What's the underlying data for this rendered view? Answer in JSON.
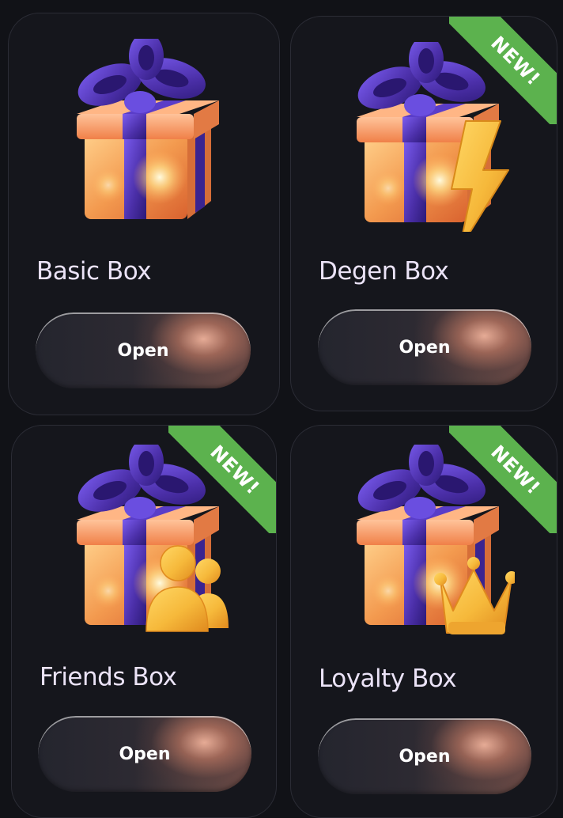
{
  "boxes": [
    {
      "title": "Basic Box",
      "button_label": "Open",
      "badge": "",
      "extra_icon": "none"
    },
    {
      "title": "Degen Box",
      "button_label": "Open",
      "badge": "NEW!",
      "extra_icon": "lightning-bolt-icon"
    },
    {
      "title": "Friends Box",
      "button_label": "Open",
      "badge": "NEW!",
      "extra_icon": "users-icon"
    },
    {
      "title": "Loyalty Box",
      "button_label": "Open",
      "badge": "NEW!",
      "extra_icon": "crown-icon"
    }
  ],
  "colors": {
    "background": "#111217",
    "card": "#15161c",
    "card_border": "#2b2c35",
    "title_text": "#ebe3f7",
    "badge_green": "#5cb24e",
    "gift_orange": "#f39a4f",
    "ribbon_purple": "#4b2fa8",
    "icon_gold": "#f6b93b"
  }
}
